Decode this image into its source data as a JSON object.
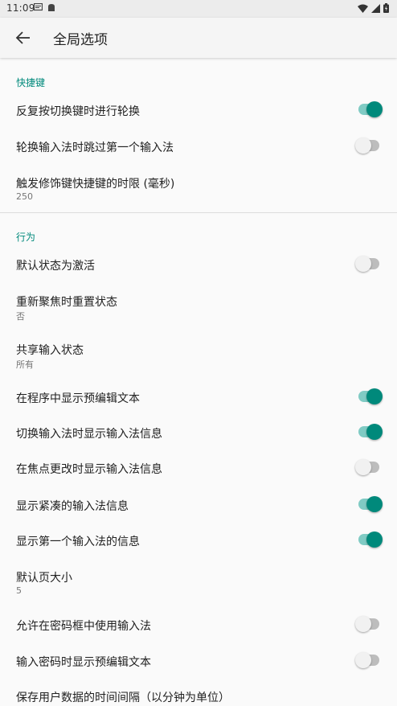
{
  "status_bar": {
    "time": "11:09"
  },
  "app_bar": {
    "title": "全局选项",
    "back_icon": "arrow-back-icon"
  },
  "colors": {
    "accent": "#00897b",
    "accent_track": "#80cbc4"
  },
  "sections": [
    {
      "header": "快捷键",
      "items": [
        {
          "label": "反复按切换键时进行轮换",
          "switch": true
        },
        {
          "label": "轮换输入法时跳过第一个输入法",
          "switch": false
        },
        {
          "label": "触发修饰键快捷键的时限 (毫秒)",
          "summary": "250"
        }
      ]
    },
    {
      "header": "行为",
      "items": [
        {
          "label": "默认状态为激活",
          "switch": false
        },
        {
          "label": "重新聚焦时重置状态",
          "summary": "否"
        },
        {
          "label": "共享输入状态",
          "summary": "所有"
        },
        {
          "label": "在程序中显示预编辑文本",
          "switch": true
        },
        {
          "label": "切换输入法时显示输入法信息",
          "switch": true
        },
        {
          "label": "在焦点更改时显示输入法信息",
          "switch": false
        },
        {
          "label": "显示紧凑的输入法信息",
          "switch": true
        },
        {
          "label": "显示第一个输入法的信息",
          "switch": true
        },
        {
          "label": "默认页大小",
          "summary": "5"
        },
        {
          "label": "允许在密码框中使用输入法",
          "switch": false
        },
        {
          "label": "输入密码时显示预编辑文本",
          "switch": false
        },
        {
          "label": "保存用户数据的时间间隔（以分钟为单位）"
        }
      ]
    }
  ]
}
